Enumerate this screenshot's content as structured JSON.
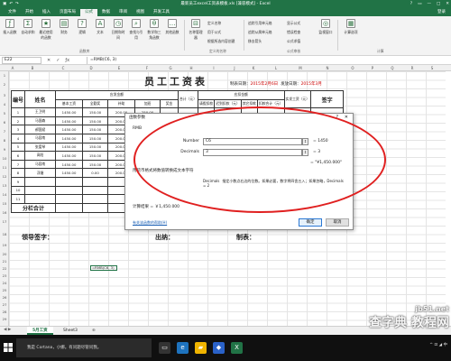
{
  "window": {
    "title": "最新员工excel工资表模板.xls [兼容模式] - Excel",
    "controls": [
      "?",
      "▭",
      "—",
      "□",
      "✕"
    ]
  },
  "ribbon_tabs": [
    "文件",
    "开始",
    "插入",
    "页面布局",
    "公式",
    "数据",
    "审阅",
    "视图",
    "开发工具"
  ],
  "active_tab": "公式",
  "user": "登录",
  "ribbon": {
    "buttons": [
      "插入函数",
      "自动求和",
      "最近使用的函数",
      "财务",
      "逻辑",
      "文本",
      "日期和时间",
      "查找与引用",
      "数学和三角函数",
      "其他函数",
      "名称管理器",
      "追踪引用单元格",
      "追踪从属单元格",
      "移去箭头",
      "显示公式",
      "错误检查",
      "公式求值",
      "监视窗口",
      "计算选项"
    ],
    "small": [
      "定义名称",
      "用于公式",
      "根据所选内容创建"
    ],
    "groups": [
      "函数库",
      "定义的名称",
      "公式审核",
      "计算"
    ]
  },
  "formula_bar": {
    "name_box": "E22",
    "formula": "=RMB(C6, 3)"
  },
  "columns": [
    "A",
    "B",
    "C",
    "D",
    "E",
    "F",
    "G",
    "H",
    "I",
    "J",
    "K",
    "L",
    "M",
    "N",
    "O",
    "P",
    "Q",
    "R",
    "S",
    "T",
    "U"
  ],
  "rows": [
    "1",
    "2",
    "3",
    "4",
    "5",
    "6",
    "7",
    "8",
    "9",
    "10",
    "11",
    "12",
    "13",
    "14",
    "15",
    "16",
    "17",
    "18",
    "19",
    "20",
    "21",
    "22",
    "23",
    "24",
    "25",
    "26",
    "27",
    "28",
    "29"
  ],
  "sheet": {
    "title": "员工工资表",
    "date_label_1": "制表日期：",
    "date_value_1": "2015年2月6日",
    "date_label_2": "发放日期：",
    "date_value_2": "2015年3月",
    "headers": {
      "num": "编号",
      "name": "姓名",
      "payable_group": "应发金额",
      "deduct_group": "应扣金额",
      "base": "基本工资",
      "allowance": "全勤奖",
      "subsidy": "补助",
      "overtime": "加班",
      "bonus": "奖金",
      "total": "合计（元）",
      "personal_tax": "请假扣款",
      "social": "迟到扣款（元）",
      "other": "其它扣款",
      "deduct_total": "扣款合计（元）",
      "actual": "实发工资（元）",
      "sign": "签字"
    },
    "employees": [
      {
        "no": "1",
        "name": "王卫明",
        "base": "1450.00",
        "allowance": "150.00",
        "subsidy": "200.00",
        "overtime": "250.00"
      },
      {
        "no": "2",
        "name": "马国森",
        "base": "1450.00",
        "allowance": "150.00",
        "subsidy": "200.00",
        "overtime": "900.00"
      },
      {
        "no": "3",
        "name": "郝国斌",
        "base": "1450.00",
        "allowance": "150.00",
        "subsidy": "200.00",
        "overtime": "250.00"
      },
      {
        "no": "4",
        "name": "马容南",
        "base": "1450.00",
        "allowance": "150.00",
        "subsidy": "200.00",
        "overtime": "500.00"
      },
      {
        "no": "5",
        "name": "张爱琴",
        "base": "1450.00",
        "allowance": "150.00",
        "subsidy": "200.00",
        "overtime": "300.00"
      },
      {
        "no": "6",
        "name": "高阳",
        "base": "1450.00",
        "allowance": "150.00",
        "subsidy": "200.00",
        "overtime": "800.00"
      },
      {
        "no": "7",
        "name": "马容南",
        "base": "1450.00",
        "allowance": "150.00",
        "subsidy": "200.00",
        "overtime": "100.00"
      },
      {
        "no": "8",
        "name": "浮嫚",
        "base": "1450.00",
        "allowance": "0.00",
        "subsidy": "200.00",
        "overtime": "600.00"
      }
    ],
    "empty_rows": [
      "9",
      "10",
      "11"
    ],
    "subtotal_label": "分栏合计",
    "sign_leader": "领导签字：",
    "sign_cashier": "出纳：",
    "sign_maker": "制表：",
    "cell_e22": "=RMB(C6, 3)"
  },
  "dialog": {
    "title": "函数参数",
    "help": "?",
    "close": "✕",
    "function_name": "RMB",
    "args": [
      {
        "label": "Number",
        "value": "C6",
        "result": "= 1450"
      },
      {
        "label": "Decimals",
        "value": "3",
        "result": "= 3"
      }
    ],
    "result_preview": "= \"¥1,450.000\"",
    "description": "用货币格式将数值转换成文本字符",
    "arg_desc_name": "Decimals",
    "arg_desc_text": "指定小数点右边的位数。如果必要，数字将四舍五入；如果忽略，Decimals = 2",
    "calc_result": "计算结果 = ￥1,450.000",
    "help_link": "有关该函数的帮助(H)",
    "ok": "确定",
    "cancel": "取消"
  },
  "sheet_tabs": {
    "nav": "◀ ▶",
    "tabs": [
      "5月工资",
      "Sheet3"
    ],
    "add": "⊕"
  },
  "taskbar": {
    "search_placeholder": "我是 Cortana，小娜。有问题尽管问我。",
    "tray": "^ ⊡ ◢ 中"
  },
  "watermark": {
    "line1": "jb51.net",
    "line2": "查字典 教程网"
  },
  "colors": {
    "excel_green": "#217346",
    "highlight_red": "#e02020",
    "date_red": "#cc0000"
  }
}
